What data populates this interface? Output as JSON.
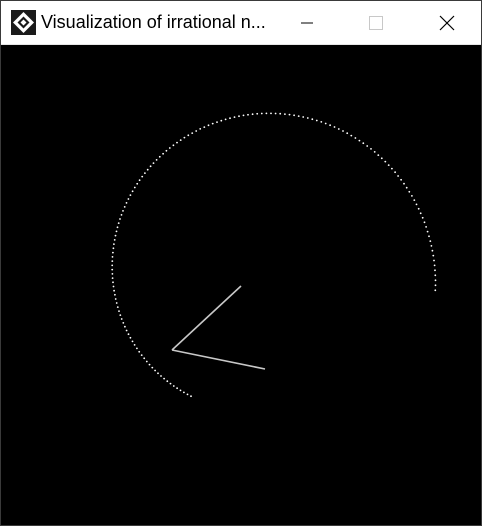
{
  "window": {
    "title": "Visualization of irrational n...",
    "icon": "app-diamond-icon",
    "controls": {
      "minimize": "minimize-icon",
      "maximize": "maximize-icon",
      "close": "close-icon"
    }
  },
  "visualization": {
    "background": "#000000",
    "dot_color": "#ffffff",
    "hand_color": "#c8c8c8"
  }
}
